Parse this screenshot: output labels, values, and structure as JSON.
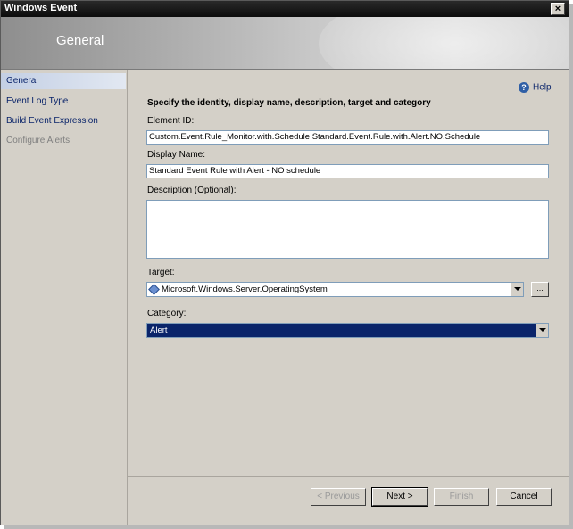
{
  "window": {
    "title": "Windows Event",
    "close_glyph": "×"
  },
  "banner": {
    "title": "General"
  },
  "nav": {
    "items": [
      {
        "label": "General",
        "state": "selected"
      },
      {
        "label": "Event Log Type",
        "state": "normal"
      },
      {
        "label": "Build Event Expression",
        "state": "normal"
      },
      {
        "label": "Configure Alerts",
        "state": "disabled"
      }
    ]
  },
  "help": {
    "label": "Help",
    "icon": "help-icon"
  },
  "form": {
    "heading": "Specify the identity, display name, description, target and category",
    "element_id_label": "Element ID:",
    "element_id_value": "Custom.Event.Rule_Monitor.with.Schedule.Standard.Event.Rule.with.Alert.NO.Schedule",
    "display_name_label": "Display Name:",
    "display_name_value": "Standard Event Rule with Alert - NO schedule",
    "description_label": "Description (Optional):",
    "description_value": "",
    "target_label": "Target:",
    "target_value": "Microsoft.Windows.Server.OperatingSystem",
    "browse_label": "...",
    "category_label": "Category:",
    "category_value": "Alert"
  },
  "buttons": {
    "previous": "< Previous",
    "next": "Next >",
    "finish": "Finish",
    "cancel": "Cancel"
  },
  "colors": {
    "title_bar": "#0c0c0c",
    "selection": "#0a246a",
    "link": "#0a246a"
  }
}
